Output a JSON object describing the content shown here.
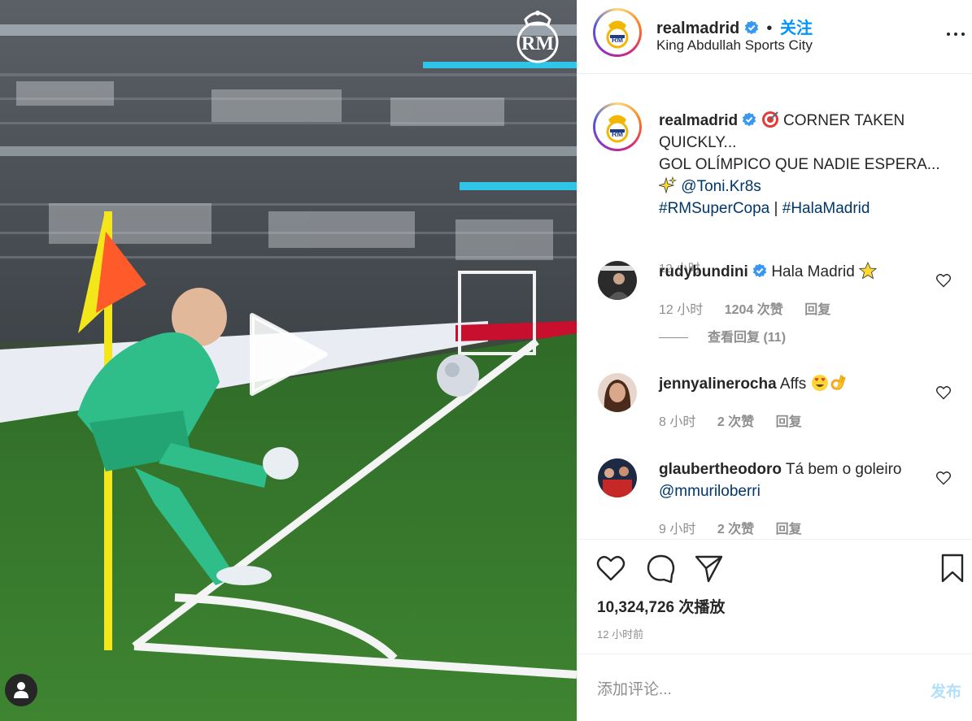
{
  "post": {
    "username": "realmadrid",
    "follow_label": "关注",
    "separator": "•",
    "location": "King Abdullah Sports City"
  },
  "caption": {
    "username": "realmadrid",
    "line1": "CORNER TAKEN QUICKLY...",
    "line2": "GOL OLÍMPICO QUE NADIE ESPERA...",
    "mention": "@Toni.Kr8s",
    "hashtag1": "#RMSuperCopa",
    "divider": "|",
    "hashtag2": "#HalaMadrid",
    "time": "12 小时"
  },
  "comments": [
    {
      "username": "rudybundini",
      "verified": true,
      "text": "Hala Madrid",
      "time": "12 小时",
      "likes": "1204 次赞",
      "reply_label": "回复",
      "view_replies": "查看回复 (11)"
    },
    {
      "username": "jennyalinerocha",
      "text": "Affs",
      "time": "8 小时",
      "likes": "2 次赞",
      "reply_label": "回复"
    },
    {
      "username": "glaubertheodoro",
      "text": "Tá bem o goleiro",
      "mention": "@mmuriloberri",
      "time": "9 小时",
      "likes": "2 次赞",
      "reply_label": "回复"
    }
  ],
  "actions": {
    "icons": [
      "heart-icon",
      "comment-icon",
      "share-icon",
      "bookmark-icon"
    ],
    "views": "10,324,726 次播放",
    "posted": "12 小时前"
  },
  "comment_box": {
    "placeholder": "添加评论...",
    "post_label": "发布"
  },
  "colors": {
    "link_blue": "#00376b",
    "follow_blue": "#0095f6",
    "secondary_text": "#8e8e8e",
    "post_disabled": "#b2dffc",
    "verified_blue": "#3897f0"
  }
}
